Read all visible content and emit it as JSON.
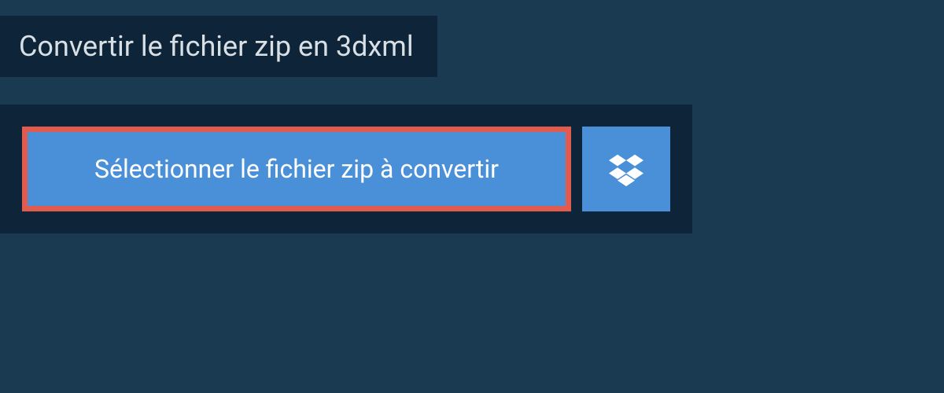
{
  "header": {
    "title": "Convertir le fichier zip en 3dxml"
  },
  "upload": {
    "select_button_label": "Sélectionner le fichier zip à convertir"
  },
  "colors": {
    "page_bg": "#1a3a52",
    "panel_bg": "#0e2438",
    "button_bg": "#4a90d9",
    "highlight_border": "#e15b4e",
    "text_light": "#ffffff",
    "text_muted": "#d8dfe5"
  }
}
